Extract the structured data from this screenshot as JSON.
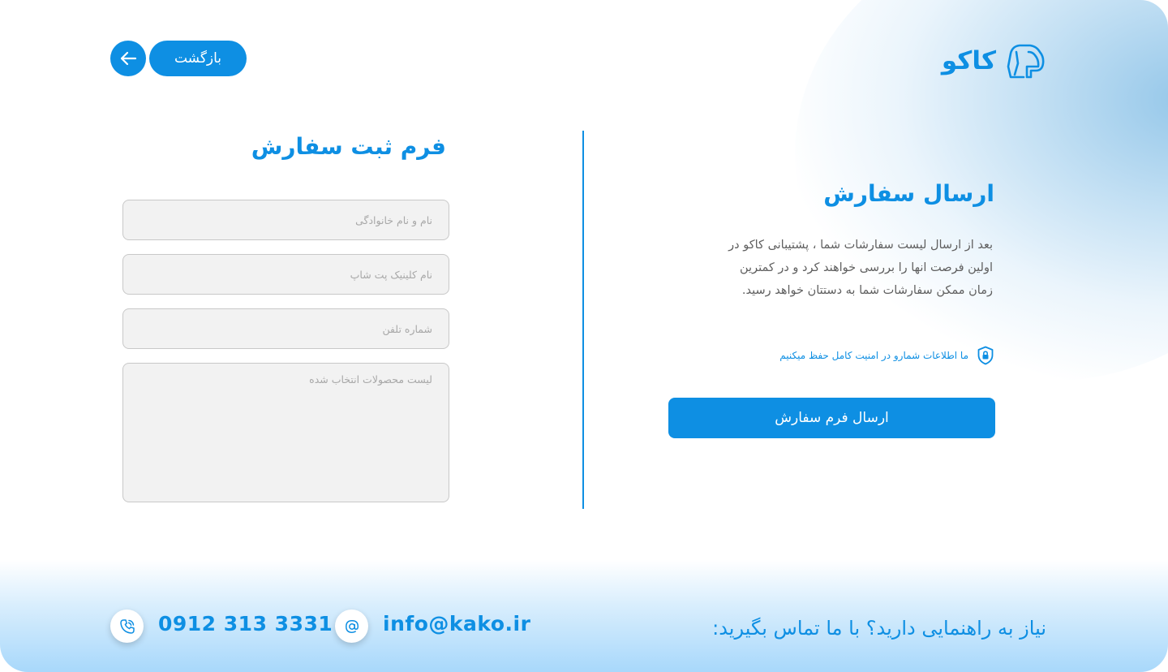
{
  "brand": {
    "name": "کاکو",
    "accent_color": "#0e8fe3",
    "logo_icon": "dog-head-icon"
  },
  "header": {
    "back_label": "بازگشت",
    "back_icon": "arrow-left-icon"
  },
  "form": {
    "title": "فرم ثبت سفارش",
    "fields": [
      {
        "placeholder": "نام و نام خانوادگی",
        "value": ""
      },
      {
        "placeholder": "نام کلینیک پت شاپ",
        "value": ""
      },
      {
        "placeholder": "شماره تلفن",
        "value": ""
      },
      {
        "placeholder": "لیست محصولات انتخاب شده",
        "value": ""
      }
    ]
  },
  "info": {
    "title": "ارسال سفارش",
    "description": "بعد از ارسال لیست سفارشات شما ، پشتیبانی کاکو در اولین فرصت انها را بررسی خواهند کرد و در کمترین زمان ممکن سفارشات شما به دستتان خواهد رسید.",
    "security_note": "ما اطلاعات شمارو در امنیت کامل حفظ میکنیم",
    "security_icon": "shield-lock-icon",
    "submit_label": "ارسال فرم سفارش"
  },
  "footer": {
    "help_text": "نیاز به راهنمایی دارید؟ با ما تماس بگیرید:",
    "email": "info@kako.ir",
    "email_icon": "at-sign-icon",
    "phone": "0912 313 3331",
    "phone_icon": "phone-icon"
  }
}
